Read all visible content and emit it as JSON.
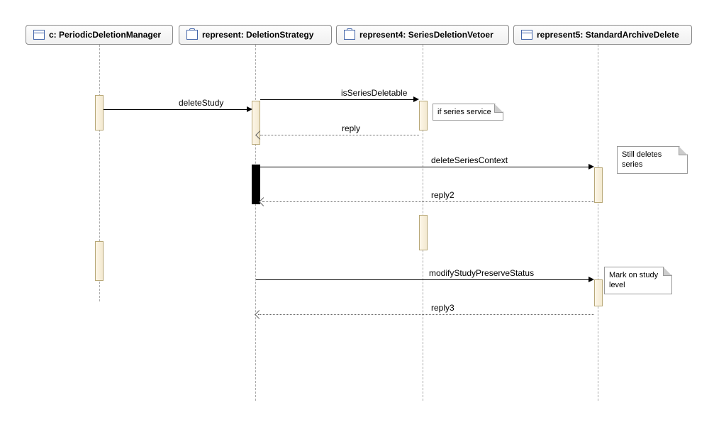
{
  "participants": {
    "p1": "c: PeriodicDeletionManager",
    "p2": "represent: DeletionStrategy",
    "p3": "represent4: SeriesDeletionVetoer",
    "p4": "represent5: StandardArchiveDelete"
  },
  "messages": {
    "deleteStudy": "deleteStudy",
    "isSeriesDeletable": "isSeriesDeletable",
    "reply": "reply",
    "deleteSeriesContext": "deleteSeriesContext",
    "reply2": "reply2",
    "modifyStudyPreserveStatus": "modifyStudyPreserveStatus",
    "reply3": "reply3"
  },
  "notes": {
    "ifSeries": "if series service",
    "stillDeletes": "Still deletes series",
    "markOn": "Mark on study level"
  },
  "chart_data": {
    "type": "sequence-diagram",
    "participants": [
      {
        "id": "c",
        "label": "c: PeriodicDeletionManager",
        "stereotype": "class"
      },
      {
        "id": "represent",
        "label": "represent: DeletionStrategy",
        "stereotype": "interface"
      },
      {
        "id": "represent4",
        "label": "represent4: SeriesDeletionVetoer",
        "stereotype": "interface"
      },
      {
        "id": "represent5",
        "label": "represent5: StandardArchiveDelete",
        "stereotype": "class"
      }
    ],
    "messages": [
      {
        "from": "c",
        "to": "represent",
        "label": "deleteStudy",
        "type": "sync"
      },
      {
        "from": "represent",
        "to": "represent4",
        "label": "isSeriesDeletable",
        "type": "sync",
        "note": "if series service"
      },
      {
        "from": "represent4",
        "to": "represent",
        "label": "reply",
        "type": "return"
      },
      {
        "from": "represent",
        "to": "represent5",
        "label": "deleteSeriesContext",
        "type": "sync",
        "note": "Still deletes series"
      },
      {
        "from": "represent5",
        "to": "represent",
        "label": "reply2",
        "type": "return"
      },
      {
        "from": "represent",
        "to": "represent5",
        "label": "modifyStudyPreserveStatus",
        "type": "sync",
        "note": "Mark on study level"
      },
      {
        "from": "represent5",
        "to": "represent",
        "label": "reply3",
        "type": "return"
      }
    ]
  }
}
